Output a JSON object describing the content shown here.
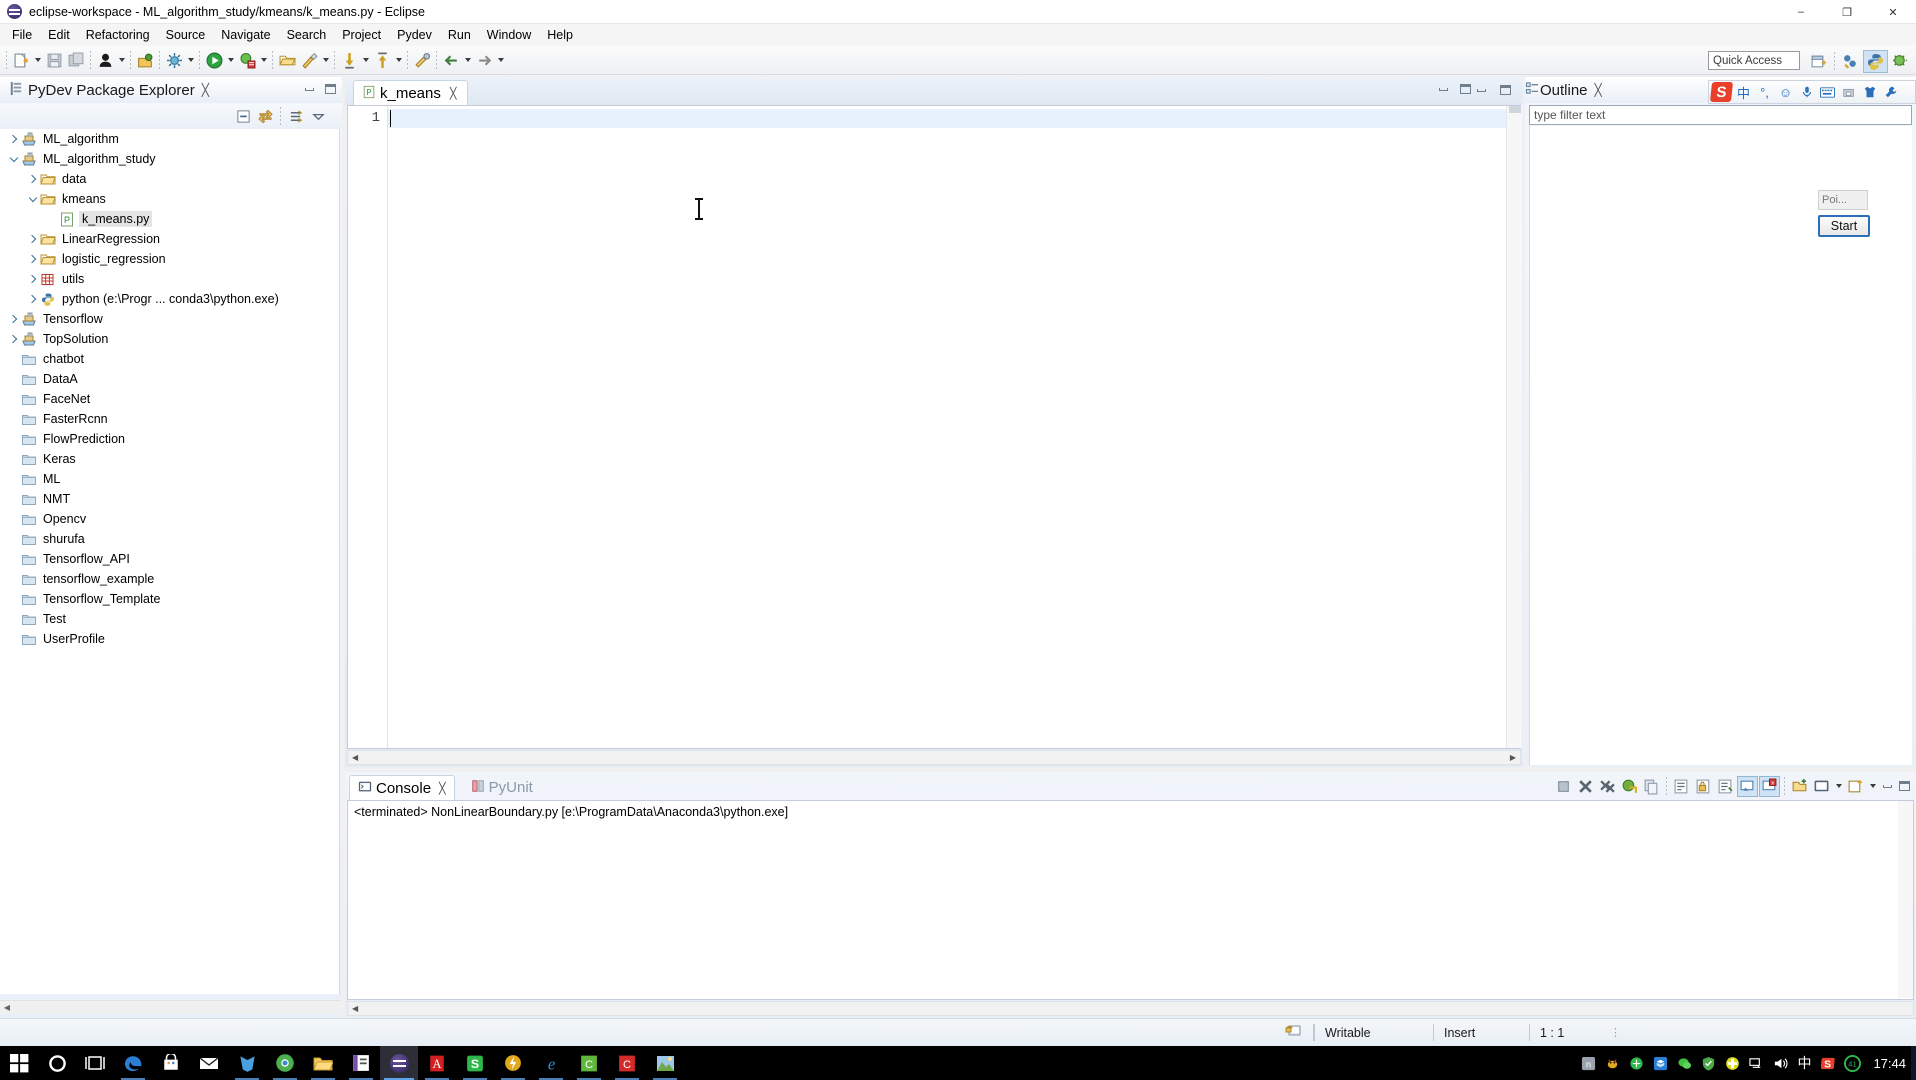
{
  "window": {
    "title": "eclipse-workspace - ML_algorithm_study/kmeans/k_means.py - Eclipse",
    "minimize": "–",
    "maximize": "❐",
    "close": "✕"
  },
  "menu": {
    "items": [
      "File",
      "Edit",
      "Refactoring",
      "Source",
      "Navigate",
      "Search",
      "Project",
      "Pydev",
      "Run",
      "Window",
      "Help"
    ]
  },
  "toolbar": {
    "quick_access_placeholder": "Quick Access",
    "icons": [
      "new-wizard-icon",
      "save-icon",
      "save-all-icon",
      "print-icon",
      "open-type-icon",
      "build-icon",
      "run-icon",
      "debug-icon",
      "open-resource-icon",
      "external-tools-icon",
      "previous-annotation-icon",
      "next-annotation-icon",
      "back-icon",
      "forward-icon"
    ],
    "perspectives": [
      "open-perspective-icon",
      "pydev-perspective-icon",
      "python-perspective-icon",
      "debug-perspective-icon"
    ]
  },
  "explorer": {
    "title": "PyDev Package Explorer",
    "close_glyph": "╳",
    "toolbar_icons": [
      "collapse-all-icon",
      "link-with-editor-icon",
      "filter-icon",
      "view-menu-icon"
    ],
    "tree": [
      {
        "label": "ML_algorithm",
        "indent": 0,
        "twisty": "collapsed",
        "icon": "pydev-project-icon",
        "selected": false
      },
      {
        "label": "ML_algorithm_study",
        "indent": 0,
        "twisty": "expanded",
        "icon": "pydev-project-icon",
        "selected": false
      },
      {
        "label": "data",
        "indent": 1,
        "twisty": "collapsed",
        "icon": "folder-icon",
        "selected": false
      },
      {
        "label": "kmeans",
        "indent": 1,
        "twisty": "expanded",
        "icon": "folder-icon",
        "selected": false
      },
      {
        "label": "k_means.py",
        "indent": 2,
        "twisty": "none",
        "icon": "python-file-icon",
        "selected": true
      },
      {
        "label": "LinearRegression",
        "indent": 1,
        "twisty": "collapsed",
        "icon": "folder-icon",
        "selected": false
      },
      {
        "label": "logistic_regression",
        "indent": 1,
        "twisty": "collapsed",
        "icon": "folder-icon",
        "selected": false
      },
      {
        "label": "utils",
        "indent": 1,
        "twisty": "collapsed",
        "icon": "source-folder-icon",
        "selected": false
      },
      {
        "label": "python  (e:\\Progr ... conda3\\python.exe)",
        "indent": 1,
        "twisty": "collapsed",
        "icon": "python-interpreter-icon",
        "selected": false
      },
      {
        "label": "Tensorflow",
        "indent": 0,
        "twisty": "collapsed",
        "icon": "pydev-project-icon",
        "selected": false
      },
      {
        "label": "TopSolution",
        "indent": 0,
        "twisty": "collapsed",
        "icon": "pydev-project-icon",
        "selected": false
      },
      {
        "label": "chatbot",
        "indent": 0,
        "twisty": "none",
        "icon": "closed-project-icon",
        "selected": false
      },
      {
        "label": "DataA",
        "indent": 0,
        "twisty": "none",
        "icon": "closed-project-icon",
        "selected": false
      },
      {
        "label": "FaceNet",
        "indent": 0,
        "twisty": "none",
        "icon": "closed-project-icon",
        "selected": false
      },
      {
        "label": "FasterRcnn",
        "indent": 0,
        "twisty": "none",
        "icon": "closed-project-icon",
        "selected": false
      },
      {
        "label": "FlowPrediction",
        "indent": 0,
        "twisty": "none",
        "icon": "closed-project-icon",
        "selected": false
      },
      {
        "label": "Keras",
        "indent": 0,
        "twisty": "none",
        "icon": "closed-project-icon",
        "selected": false
      },
      {
        "label": "ML",
        "indent": 0,
        "twisty": "none",
        "icon": "closed-project-icon",
        "selected": false
      },
      {
        "label": "NMT",
        "indent": 0,
        "twisty": "none",
        "icon": "closed-project-icon",
        "selected": false
      },
      {
        "label": "Opencv",
        "indent": 0,
        "twisty": "none",
        "icon": "closed-project-icon",
        "selected": false
      },
      {
        "label": "shurufa",
        "indent": 0,
        "twisty": "none",
        "icon": "closed-project-icon",
        "selected": false
      },
      {
        "label": "Tensorflow_API",
        "indent": 0,
        "twisty": "none",
        "icon": "closed-project-icon",
        "selected": false
      },
      {
        "label": "tensorflow_example",
        "indent": 0,
        "twisty": "none",
        "icon": "closed-project-icon",
        "selected": false
      },
      {
        "label": "Tensorflow_Template",
        "indent": 0,
        "twisty": "none",
        "icon": "closed-project-icon",
        "selected": false
      },
      {
        "label": "Test",
        "indent": 0,
        "twisty": "none",
        "icon": "closed-project-icon",
        "selected": false
      },
      {
        "label": "UserProfile",
        "indent": 0,
        "twisty": "none",
        "icon": "closed-project-icon",
        "selected": false
      }
    ]
  },
  "editor": {
    "tab_label": "k_means",
    "tab_close_glyph": "╳",
    "line_numbers": [
      "1"
    ],
    "code_lines": [
      ""
    ],
    "scroll_left_glyph": "◀",
    "scroll_right_glyph": "▶"
  },
  "outline": {
    "title": "Outline",
    "close_glyph": "╳",
    "filter_placeholder": "type filter text",
    "filter_value": ""
  },
  "sogou": {
    "logo": "S",
    "icons": [
      "中",
      "°,",
      "☺",
      "🎤",
      "⌨",
      "📇",
      "👕",
      "🔧"
    ]
  },
  "start_popup": {
    "label": "Poi...",
    "button": "Start"
  },
  "console": {
    "tab_label": "Console",
    "tab_close_glyph": "╳",
    "inactive_tab_label": "PyUnit",
    "output": "<terminated> NonLinearBoundary.py [e:\\ProgramData\\Anaconda3\\python.exe]",
    "toolbar_icons": [
      "terminate-icon",
      "remove-launch-icon",
      "remove-all-terminated-icon",
      "relaunch-icon",
      "copy-icon",
      "word-wrap-icon",
      "scroll-lock-icon",
      "clear-console-icon",
      "pin-console-icon",
      "display-console-icon",
      "open-console-icon",
      "new-console-view-icon",
      "minimize-icon",
      "maximize-icon"
    ],
    "scroll_left_glyph": "◀"
  },
  "statusbar": {
    "lock_icon": "writable-lock-icon",
    "writable": "Writable",
    "insert": "Insert",
    "position": "1 : 1",
    "resize_grip": "⋮"
  },
  "taskbar": {
    "start": "⊞",
    "items": [
      "windows-start-icon",
      "cortana-search-icon",
      "task-view-icon",
      "edge-icon",
      "store-icon",
      "mail-icon",
      "wps-icon",
      "chrome-icon",
      "explorer-icon",
      "onenote-icon",
      "eclipse-icon",
      "acrobat-icon",
      "sogou-icon",
      "thunder-icon",
      "ie-icon",
      "cpp-icon",
      "c-icon",
      "photo-icon"
    ],
    "tray": [
      "n-icon",
      "pest-icon",
      "browser-icon",
      "box-icon",
      "wechat-icon",
      "shield-icon",
      "cross-icon",
      "network-icon",
      "volume-icon",
      "ime-chinese-icon",
      "sogou-tray-icon",
      "battery-41-icon"
    ],
    "ime_label": "中",
    "battery": "41",
    "clock": "17:44"
  },
  "colors": {
    "accent": "#2a6fb8",
    "tab_selected_bg": "#ffffff",
    "editor_bg": "#ffffff",
    "panel_bg": "#eaf0f7",
    "taskbar_bg": "#000000",
    "sogou_red": "#e8402a"
  }
}
